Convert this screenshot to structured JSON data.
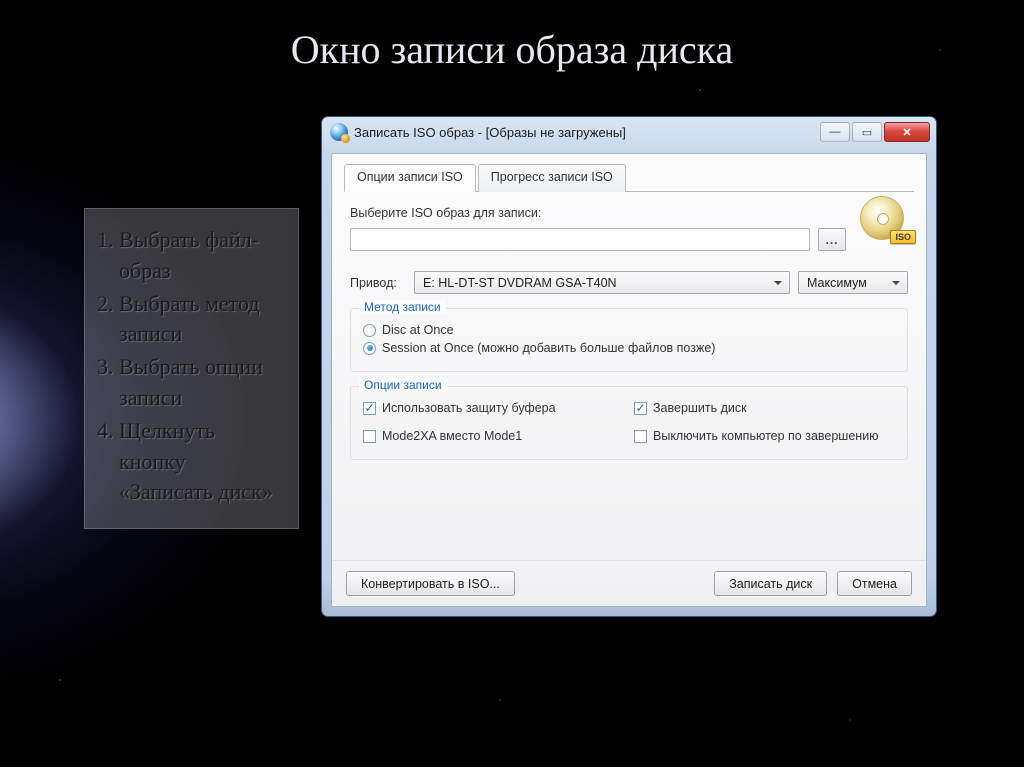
{
  "slide": {
    "title": "Окно записи образа диска",
    "steps": [
      "Выбрать файл-образ",
      "Выбрать метод записи",
      "Выбрать опции записи",
      "Щелкнуть кнопку «Записать диск»"
    ]
  },
  "window": {
    "title": "Записать ISO образ - [Образы не загружены]",
    "tabs": {
      "iso_options": "Опции записи ISO",
      "iso_progress": "Прогресс записи ISO"
    },
    "select_iso_label": "Выберите ISO образ для записи:",
    "iso_path": "",
    "browse": "...",
    "iso_badge": "ISO",
    "drive_label": "Привод:",
    "drive_value": "E: HL-DT-ST DVDRAM GSA-T40N",
    "speed_value": "Максимум",
    "method_group": {
      "legend": "Метод записи",
      "disc_at_once": "Disc at Once",
      "session_at_once": "Session at Once (можно добавить больше файлов позже)",
      "selected": "session_at_once"
    },
    "options_group": {
      "legend": "Опции записи",
      "buffer_protect": {
        "label": "Использовать защиту буфера",
        "checked": true
      },
      "finalize": {
        "label": "Завершить диск",
        "checked": true
      },
      "mode2xa": {
        "label": "Mode2XA вместо Mode1",
        "checked": false
      },
      "shutdown": {
        "label": "Выключить компьютер по завершению",
        "checked": false
      }
    },
    "buttons": {
      "convert": "Конвертировать в ISO...",
      "burn": "Записать диск",
      "cancel": "Отмена"
    }
  }
}
